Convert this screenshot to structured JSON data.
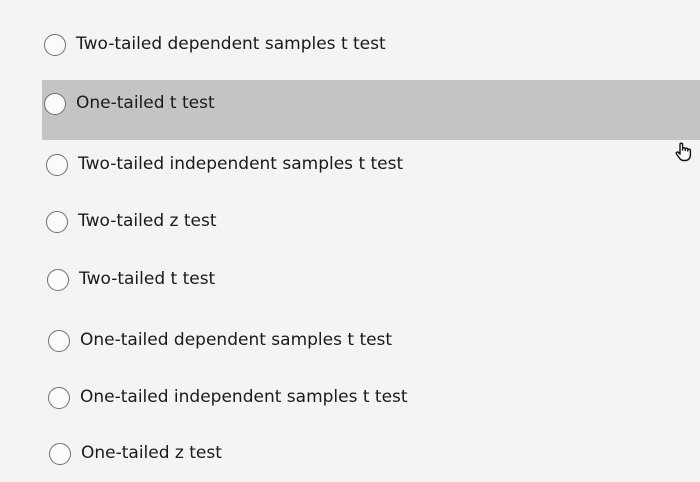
{
  "question": {
    "options": [
      {
        "label": "Two-tailed dependent samples t test",
        "selected": false,
        "hovered": false
      },
      {
        "label": "One-tailed t test",
        "selected": false,
        "hovered": true
      },
      {
        "label": "Two-tailed independent samples t test",
        "selected": false,
        "hovered": false
      },
      {
        "label": "Two-tailed z test",
        "selected": false,
        "hovered": false
      },
      {
        "label": "Two-tailed t test",
        "selected": false,
        "hovered": false
      },
      {
        "label": "One-tailed dependent samples t test",
        "selected": false,
        "hovered": false
      },
      {
        "label": "One-tailed independent samples t test",
        "selected": false,
        "hovered": false
      },
      {
        "label": "One-tailed z test",
        "selected": false,
        "hovered": false
      }
    ]
  },
  "colors": {
    "background": "#f4f4f4",
    "highlight": "#c4c4c4",
    "radio_border": "#6f6f6f",
    "text": "#1a1a1a"
  },
  "icons": {
    "cursor": "hand-pointer-icon"
  }
}
